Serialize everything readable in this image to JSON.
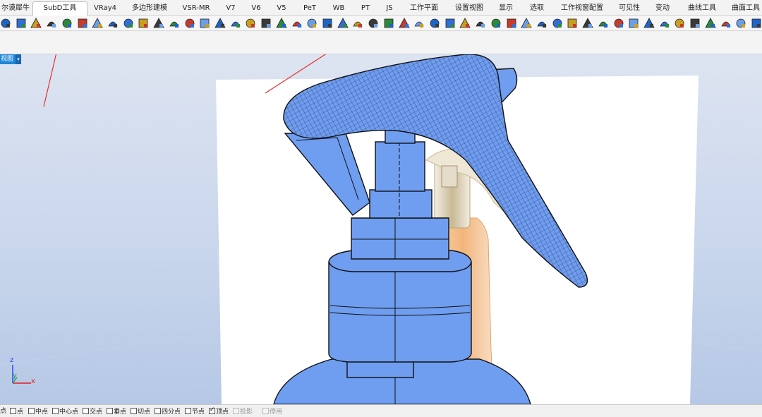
{
  "tabs": [
    {
      "label": "尔谟犀牛"
    },
    {
      "label": "SubD工具",
      "active": true
    },
    {
      "label": "VRay4"
    },
    {
      "label": "多边形建模"
    },
    {
      "label": "VSR-MR"
    },
    {
      "label": "V7"
    },
    {
      "label": "V6"
    },
    {
      "label": "V5"
    },
    {
      "label": "PeT"
    },
    {
      "label": "WB"
    },
    {
      "label": "PT"
    },
    {
      "label": "JS"
    },
    {
      "label": "工作平面"
    },
    {
      "label": "设置视图"
    },
    {
      "label": "显示"
    },
    {
      "label": "选取"
    },
    {
      "label": "工作视窗配置"
    },
    {
      "label": "可见性"
    },
    {
      "label": "变动"
    },
    {
      "label": "曲线工具"
    },
    {
      "label": "曲面工具"
    }
  ],
  "toolbar": {
    "icons": [
      "subd-ball-icon",
      "subd-cylinder-icon",
      "subd-sphere-icon",
      "subd-ellipsoid-icon",
      "subd-torus-icon",
      "subd-box-icon",
      "subd-loft-icon",
      "subd-sweep-icon",
      "subd-tripod-icon",
      "subd-patch-icon",
      "subd-crease-icon",
      "subd-edge-select-icon",
      "subd-pencil-icon",
      "subd-grid-icon",
      "subd-bridge-icon",
      "subd-vertex-icon",
      "subd-cube-icon",
      "subd-panel-icon",
      "subd-frame-icon",
      "subd-globe-icon",
      "subd-align-icon",
      "subd-knife-icon",
      "subd-mesh-icon",
      "subd-fill-icon",
      "subd-bucket-icon",
      "subd-drop-icon",
      "subd-grid-mesh-icon",
      "subd-cheese-icon",
      "subd-cage-icon",
      "subd-extrude-icon",
      "subd-solid-icon",
      "subd-dots-icon",
      "subd-chip-icon",
      "subd-ring-icon",
      "subd-list-icon",
      "subd-wrench-icon",
      "subd-puzzle-icon",
      "subd-cone-icon",
      "subd-sun-icon",
      "subd-half-sphere-icon",
      "subd-no-icon",
      "subd-funnel-icon",
      "subd-move-icon",
      "subd-house-icon",
      "subd-stack-icon",
      "subd-layers-icon",
      "subd-wave-icon",
      "subd-box-select-icon",
      "subd-bucket-fill-icon",
      "subd-close-icon"
    ],
    "icon_palette": [
      "#1e64c8",
      "#2f6fd6",
      "#c8a020",
      "#3a3a3a",
      "#2a8a3a",
      "#c83a2a",
      "#6a9ee8"
    ]
  },
  "viewport": {
    "label": "视图"
  },
  "axes": {
    "z": "z",
    "x": "x",
    "y": "y"
  },
  "osnaps": [
    {
      "label": "点",
      "checked": false,
      "box": false
    },
    {
      "label": "点",
      "checked": false
    },
    {
      "label": "中点",
      "checked": false
    },
    {
      "label": "中心点",
      "checked": false
    },
    {
      "label": "交点",
      "checked": false
    },
    {
      "label": "垂点",
      "checked": false
    },
    {
      "label": "切点",
      "checked": false
    },
    {
      "label": "四分点",
      "checked": false
    },
    {
      "label": "节点",
      "checked": false
    },
    {
      "label": "顶点",
      "checked": true
    },
    {
      "label": "投影",
      "checked": false,
      "disabled": true
    },
    {
      "label": "停用",
      "checked": false,
      "disabled": true
    }
  ],
  "colors": {
    "subd_blue": "#6f9df0",
    "subd_dark": "#3f73cf",
    "bottle_amber": "#f0b880",
    "chrome": "#d8cab0",
    "annotation_red": "#e8302a",
    "viewport_tab": "#1e86d6"
  }
}
